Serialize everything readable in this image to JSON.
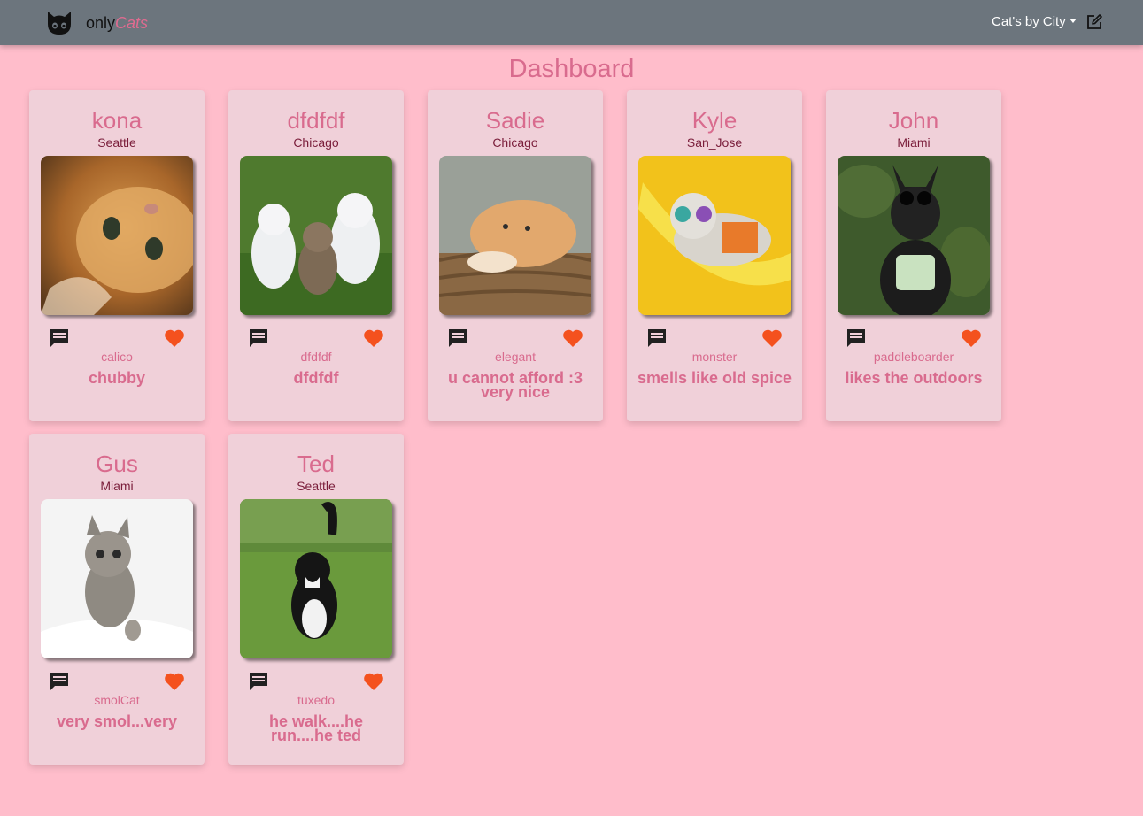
{
  "nav": {
    "brand_prefix": "only",
    "brand_accent": "Cats",
    "dropdown_label": "Cat's by City"
  },
  "page": {
    "title": "Dashboard"
  },
  "cats": [
    {
      "name": "kona",
      "city": "Seattle",
      "tag": "calico",
      "description": "chubby"
    },
    {
      "name": "dfdfdf",
      "city": "Chicago",
      "tag": "dfdfdf",
      "description": "dfdfdf"
    },
    {
      "name": "Sadie",
      "city": "Chicago",
      "tag": "elegant",
      "description": "u cannot afford :3 very nice"
    },
    {
      "name": "Kyle",
      "city": "San_Jose",
      "tag": "monster",
      "description": "smells like old spice"
    },
    {
      "name": "John",
      "city": "Miami",
      "tag": "paddleboarder",
      "description": "likes the outdoors"
    },
    {
      "name": "Gus",
      "city": "Miami",
      "tag": "smolCat",
      "description": "very smol...very"
    },
    {
      "name": "Ted",
      "city": "Seattle",
      "tag": "tuxedo",
      "description": "he walk....he run....he ted"
    }
  ],
  "colors": {
    "background": "#ffbdcb",
    "navbar": "#6c757d",
    "card": "#f0d0d9",
    "accent": "#d96b8e",
    "heart": "#f4511e"
  },
  "icons": {
    "brand": "cat-face-icon",
    "edit": "edit-square-icon",
    "comment": "comment-icon",
    "like": "heart-icon"
  }
}
